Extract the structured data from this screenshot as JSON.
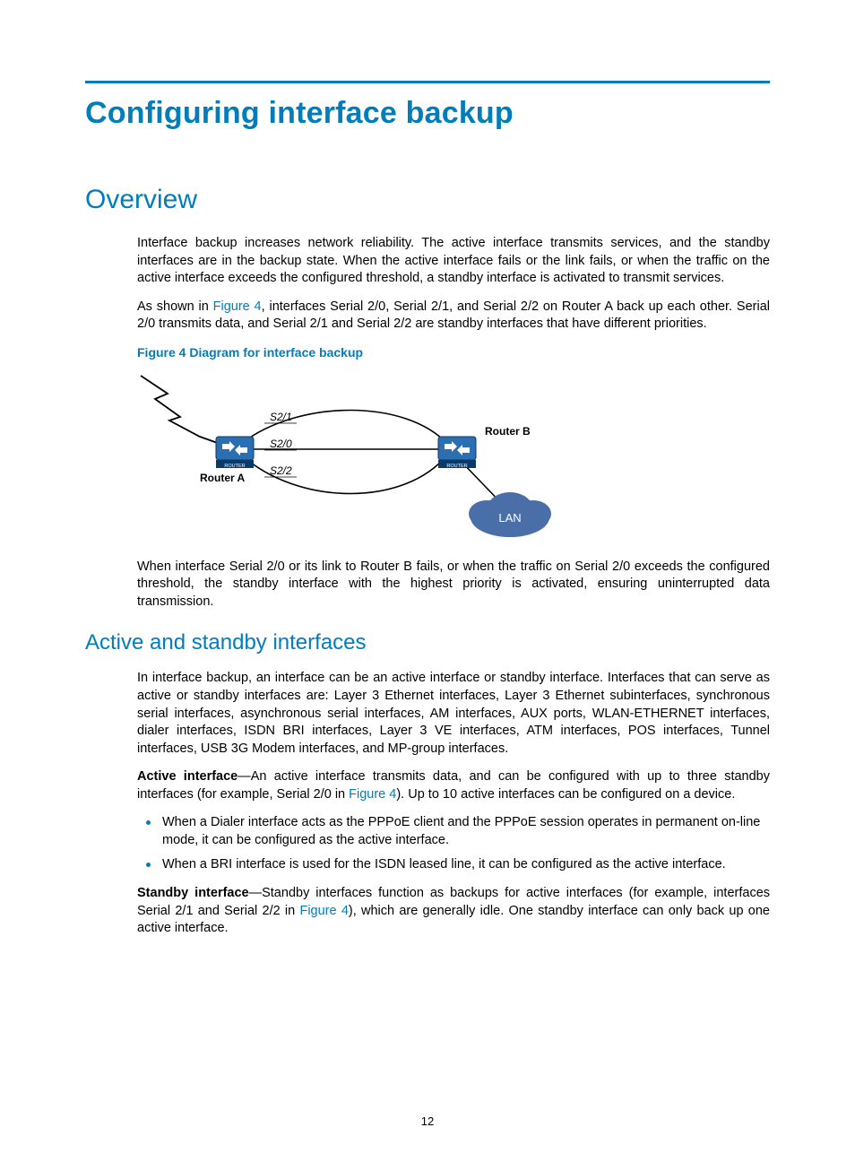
{
  "title": "Configuring interface backup",
  "section_overview": "Overview",
  "p1": "Interface backup increases network reliability. The active interface transmits services, and the standby interfaces are in the backup state. When the active interface fails or the link fails, or when the traffic on the active interface exceeds the configured threshold, a standby interface is activated to transmit services.",
  "p2_a": "As shown in ",
  "p2_link": "Figure 4",
  "p2_b": ", interfaces Serial 2/0, Serial 2/1, and Serial 2/2 on Router A back up each other. Serial 2/0 transmits data, and Serial 2/1 and Serial 2/2 are standby interfaces that have different priorities.",
  "fig_caption": "Figure 4 Diagram for interface backup",
  "diagram": {
    "router_a": "Router A",
    "router_b": "Router B",
    "s21": "S2/1",
    "s20": "S2/0",
    "s22": "S2/2",
    "lan": "LAN",
    "router_label": "ROUTER"
  },
  "p3": "When interface Serial 2/0 or its link to Router B fails, or when the traffic on Serial 2/0 exceeds the configured threshold, the standby interface with the highest priority is activated, ensuring uninterrupted data transmission.",
  "subsection_active": "Active and standby interfaces",
  "p4": "In interface backup, an interface can be an active interface or standby interface. Interfaces that can serve as active or standby interfaces are: Layer 3 Ethernet interfaces, Layer 3 Ethernet subinterfaces, synchronous serial interfaces, asynchronous serial interfaces, AM interfaces, AUX ports, WLAN-ETHERNET interfaces, dialer interfaces, ISDN BRI interfaces, Layer 3 VE interfaces, ATM interfaces, POS interfaces, Tunnel interfaces, USB 3G Modem interfaces, and MP-group interfaces.",
  "active_label": "Active interface",
  "p5_a": "—An active interface transmits data, and can be configured with up to three standby interfaces (for example, Serial 2/0 in ",
  "p5_link": "Figure 4",
  "p5_b": "). Up to 10 active interfaces can be configured on a device.",
  "bullet1": "When a Dialer interface acts as the PPPoE client and the PPPoE session operates in permanent on-line mode, it can be configured as the active interface.",
  "bullet2": "When a BRI interface is used for the ISDN leased line, it can be configured as the active interface.",
  "standby_label": "Standby interface",
  "p6_a": "—Standby interfaces function as backups for active interfaces (for example, interfaces Serial 2/1 and Serial 2/2 in ",
  "p6_link": "Figure 4",
  "p6_b": "), which are generally idle. One standby interface can only back up one active interface.",
  "page_number": "12"
}
